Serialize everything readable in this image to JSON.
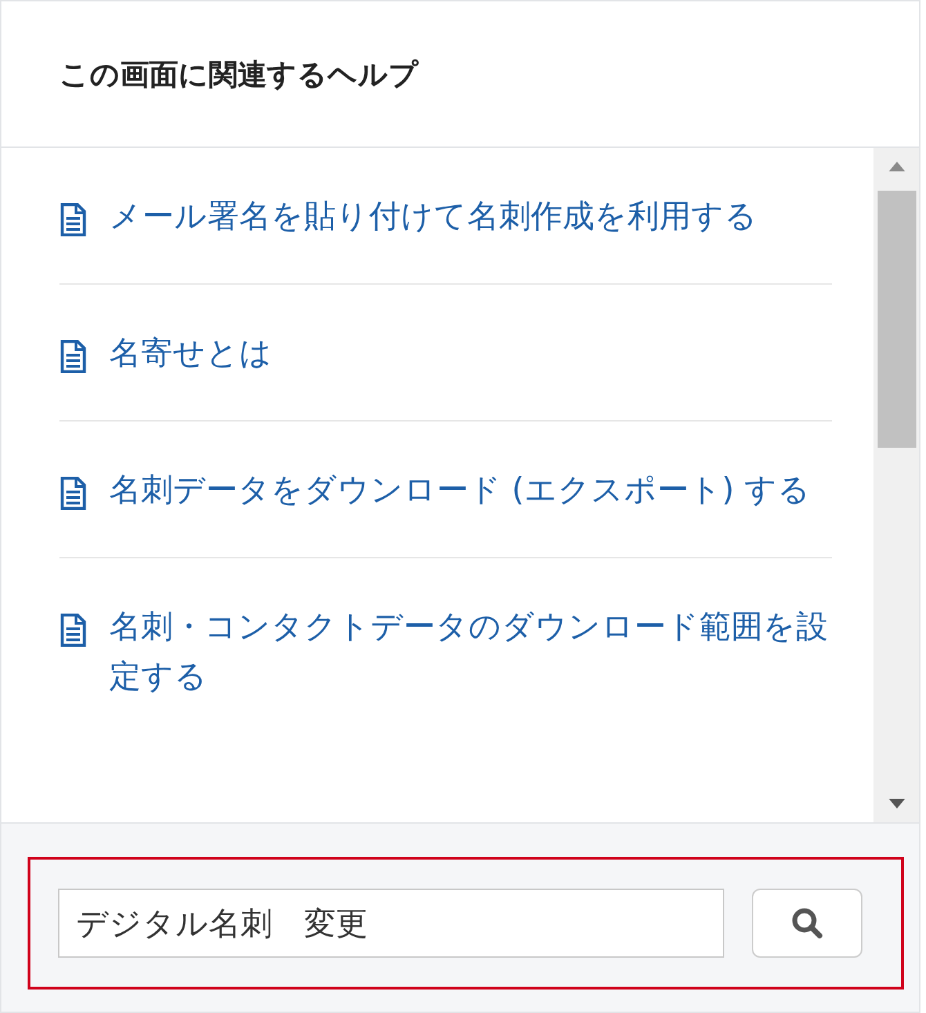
{
  "panel": {
    "title": "この画面に関連するヘルプ"
  },
  "articles": [
    {
      "title": "メール署名を貼り付けて名刺作成を利用する"
    },
    {
      "title": "名寄せとは"
    },
    {
      "title": "名刺データをダウンロード (エクスポート) する"
    },
    {
      "title": "名刺・コンタクトデータのダウンロード範囲を設定する"
    }
  ],
  "search": {
    "value": "デジタル名刺　変更",
    "highlighted": true
  }
}
